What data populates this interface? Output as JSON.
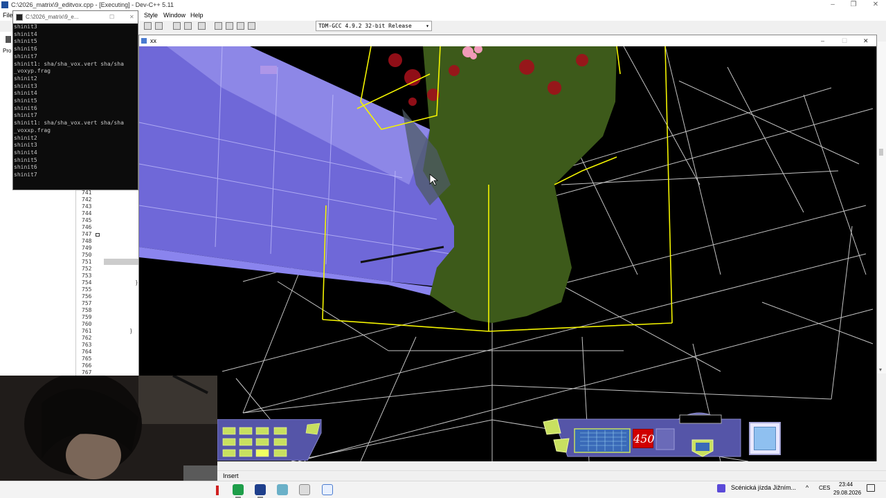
{
  "ide": {
    "title": "C:\\2026_matrix\\9_editvox.cpp - [Executing] - Dev-C++ 5.11",
    "menu": [
      "File",
      "Style",
      "Window",
      "Help"
    ],
    "compiler": "TDM-GCC 4.9.2 32-bit Release",
    "left_panel_label": "Pro",
    "line_numbers": [
      "741",
      "742",
      "743",
      "744",
      "745",
      "746",
      "747",
      "748",
      "749",
      "750",
      "751",
      "752",
      "753",
      "754",
      "755",
      "756",
      "757",
      "758",
      "759",
      "760",
      "761",
      "762",
      "763",
      "764",
      "765",
      "766",
      "767"
    ],
    "status_mode": "Insert"
  },
  "console": {
    "title": "C:\\2026_matrix\\9_e...",
    "lines": [
      "shinit3",
      "shinit4",
      "shinit5",
      "shinit6",
      "shinit7",
      "shinit1: sha/sha_vox.vert sha/sha",
      "_voxyp.frag",
      "shinit2",
      "shinit3",
      "shinit4",
      "shinit5",
      "shinit6",
      "shinit7",
      "shinit1: sha/sha_vox.vert sha/sha",
      "_voxxp.frag",
      "shinit2",
      "shinit3",
      "shinit4",
      "shinit5",
      "shinit6",
      "shinit7"
    ]
  },
  "game": {
    "title": "xx",
    "hud_counter": "450"
  },
  "taskbar": {
    "notification": "Scénická jízda Jižním...",
    "language": "CES",
    "time": "23:44",
    "date": "29.08.2026"
  },
  "colors": {
    "voxel_block": "#6f68d8",
    "foliage": "#3d5a1a",
    "wire_yellow": "#f4f400",
    "hud_red": "#d00000"
  }
}
